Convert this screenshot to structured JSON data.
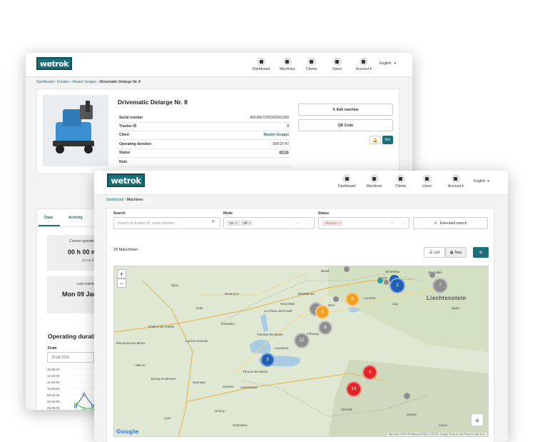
{
  "nav": {
    "items": [
      "Dashboard",
      "Machines",
      "Clients",
      "Users",
      "Account ▾"
    ],
    "language": "English"
  },
  "back": {
    "logo": "wetrok",
    "breadcrumb": [
      "Dashboard",
      "Kunden",
      "Muster Gruppe",
      "Drivematic Delarge Nr. 8"
    ],
    "machine_title": "Drivematic Delarge Nr. 8",
    "details": [
      {
        "key": "Serial number",
        "value": "450166-5781920301300"
      },
      {
        "key": "Tracker ID",
        "value": "8"
      },
      {
        "key": "Client",
        "value": "Muster Gruppe"
      },
      {
        "key": "Operating duration",
        "value": "500:07:47"
      },
      {
        "key": "Status",
        "value": "Off"
      },
      {
        "key": "Note",
        "value": ""
      }
    ],
    "edit_button": "✎ Edit machine",
    "qr_button": "QR Code",
    "bell_icon": "bell-icon",
    "toggle_label": "Ein",
    "tabs": [
      "Data",
      "Activity"
    ],
    "current_op_label": "Current operating",
    "current_op_value": "00 h 00 m",
    "current_op_date": "(23.05.201",
    "last_maint_label": "Last mainten",
    "last_maint_value": "Mon 09 Jan",
    "op_duration_title": "Operating durati",
    "from_label": "From",
    "from_value": "23.04.2019",
    "chart_data": {
      "type": "line",
      "title": "Operating durati",
      "y_ticks": [
        "15:00:00",
        "13:20:00",
        "11:40:00",
        "10:00:00",
        "08:20:00",
        "06:40:00",
        "05:00:00",
        "03:20:00",
        "01:40:00",
        "00:00:00"
      ],
      "series": [
        {
          "color": "#2260b4",
          "values": [
            5.3,
            8.5,
            5.5,
            6.3
          ]
        },
        {
          "color": "#3cb043",
          "values": [
            6.0,
            4.8,
            4.8,
            4.9
          ]
        }
      ]
    }
  },
  "front": {
    "logo": "wetrok",
    "breadcrumb": [
      "Dashboard",
      "Machines"
    ],
    "search_label": "Search",
    "search_placeholder": "Search by tracker ID, serial number...",
    "mode_label": "Mode",
    "mode_tags": [
      "On",
      "Off"
    ],
    "status_label": "Status",
    "status_tags": [
      "Attention"
    ],
    "extended_search": "Extended search",
    "count_label": "29 Maschinen",
    "list_button": "List",
    "map_button": "Map",
    "map": {
      "places": [
        "Basel",
        "Winterthur",
        "Zürich",
        "St. Gallen",
        "Dijon",
        "Besançon",
        "Biel/Bienne",
        "Neuchâtel",
        "Fribourg",
        "Lucerne",
        "Bern",
        "Yverdon-les-Bains",
        "Lausanne",
        "Genève",
        "Annemasse",
        "Thonon-les-Bains",
        "Zermatt",
        "Zug",
        "Chalon-sur-Saône",
        "Montceau-les-Mines",
        "Bourg-en-Bresse",
        "Mâcon",
        "Lyon",
        "Chambéry",
        "La Chaux-de-Fonds",
        "Pontarlier",
        "Vaduz",
        "Varese",
        "Lecco",
        "Dole",
        "Lons-le-Saunier",
        "Oyonnax",
        "Annecy"
      ],
      "country_label": "Liechtenstein",
      "clusters": [
        {
          "label": "2",
          "color": "blue"
        },
        {
          "label": "7",
          "color": "gray"
        },
        {
          "label": "6",
          "color": "orange"
        },
        {
          "label": "6",
          "color": "orange"
        },
        {
          "label": "6",
          "color": "gray"
        },
        {
          "label": "12",
          "color": "gray"
        },
        {
          "label": "3",
          "color": "blue"
        },
        {
          "label": "4",
          "color": "red"
        },
        {
          "label": "14",
          "color": "red"
        }
      ],
      "attribution": "Map data ©2019 GeoBasis-DE/BKG (©2009), Google  Terms of Use  Report a map error",
      "google": "Google"
    }
  }
}
